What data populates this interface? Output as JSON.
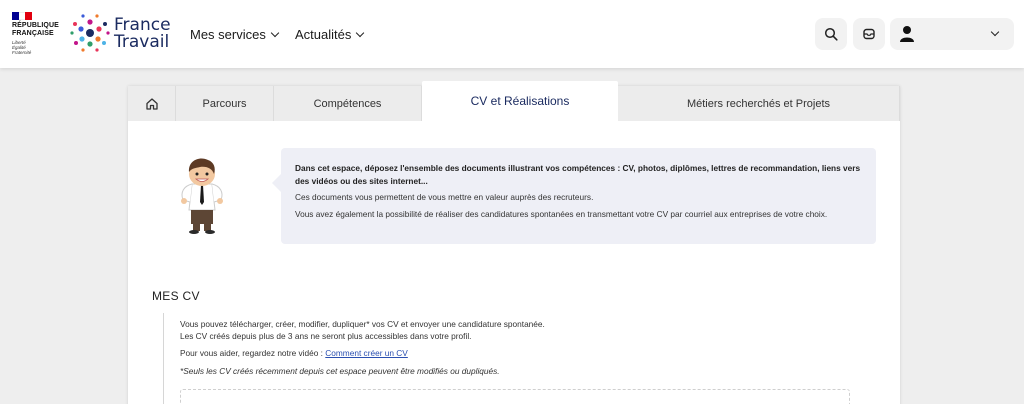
{
  "branding": {
    "republic_lines": [
      "RÉPUBLIQUE",
      "FRANÇAISE"
    ],
    "motto_lines": [
      "Liberté",
      "Égalité",
      "Fraternité"
    ],
    "app_name_lines": [
      "France",
      "Travail"
    ]
  },
  "nav": {
    "items": [
      {
        "label": "Mes services"
      },
      {
        "label": "Actualités"
      }
    ]
  },
  "header_actions": {
    "search_icon": "search-icon",
    "messages_icon": "mail-icon",
    "user_icon": "user-icon"
  },
  "tabs": [
    {
      "label": "",
      "icon": "home-icon"
    },
    {
      "label": "Parcours"
    },
    {
      "label": "Compétences"
    },
    {
      "label": "CV et Réalisations",
      "active": true
    },
    {
      "label": "Métiers recherchés et Projets"
    }
  ],
  "info_box": {
    "lead": "Dans cet espace, déposez l'ensemble des documents illustrant vos compétences : CV, photos, diplômes, lettres de recommandation, liens vers des vidéos ou des sites internet...",
    "p2": "Ces documents vous permettent de vous mettre en valeur auprès des recruteurs.",
    "p3": "Vous avez également la possibilité de réaliser des candidatures spontanées en transmettant votre CV par courriel aux entreprises de votre choix."
  },
  "mes_cv": {
    "title": "MES CV",
    "line1": "Vous pouvez télécharger, créer, modifier, dupliquer* vos CV et envoyer une candidature spontanée.",
    "line2": "Les CV créés depuis plus de 3 ans ne seront plus accessibles dans votre profil.",
    "help_prefix": "Pour vous aider, regardez notre vidéo : ",
    "help_link": "Comment créer un CV",
    "note": "*Seuls les CV créés récemment depuis cet espace peuvent être modifiés ou dupliqués."
  },
  "colors": {
    "brand_navy": "#1b2b60",
    "info_bg": "#eeeff6",
    "link": "#2a4fb0",
    "flag_blue": "#000091",
    "flag_red": "#e1000f"
  }
}
